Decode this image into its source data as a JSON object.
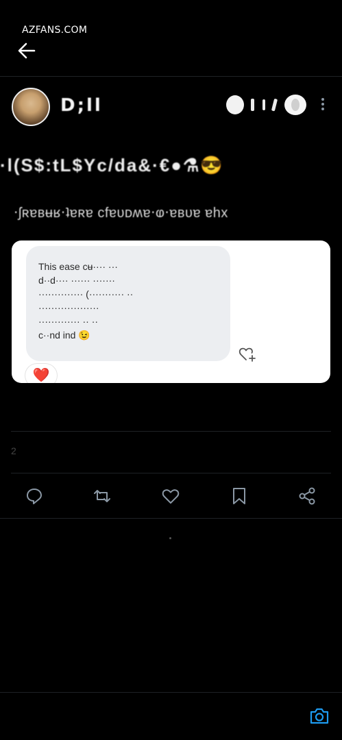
{
  "watermark": "AZFANS.COM",
  "header": {
    "back_icon": "arrow-left-icon"
  },
  "author": {
    "display_name": "D;ll",
    "avatar_icon": "profile-avatar"
  },
  "post": {
    "line1": "·l(S$:tL$Yc/da&·€●⚗😎",
    "line2": "‧ʃʀɐʙʉʁ‧ʇɐʀɐ cfɐᴜᴅʍɐ‧ⱷ‧ɐʙᴜɐ ɐhx"
  },
  "screenshot_card": {
    "bubble_text": "This ease cʉ···· ···\nd··d···· ······ ·······\n·············· (··········· ··\n···················\n············· ·· ··\nc··nd ind 😉",
    "reaction_emoji": "❤️",
    "react_icon": "heart-plus-icon"
  },
  "stats": {
    "text": "2"
  },
  "actions": [
    {
      "name": "reply-icon"
    },
    {
      "name": "repost-icon"
    },
    {
      "name": "like-icon"
    },
    {
      "name": "bookmark-icon"
    },
    {
      "name": "share-icon"
    }
  ],
  "footer": {
    "camera_icon": "camera-icon"
  },
  "colors": {
    "background": "#000000",
    "icon": "#8b98a5",
    "accent": "#1d9bf0",
    "card": "#ffffff",
    "bubble": "#eceef1"
  }
}
